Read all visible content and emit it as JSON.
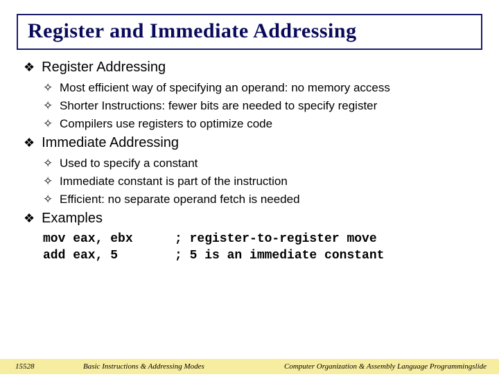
{
  "title": "Register and Immediate Addressing",
  "sections": [
    {
      "heading": "Register Addressing",
      "items": [
        "Most efficient way of specifying an operand: no memory access",
        "Shorter Instructions: fewer bits are needed to specify register",
        "Compilers use registers to optimize code"
      ]
    },
    {
      "heading": "Immediate Addressing",
      "items": [
        "Used to specify a constant",
        "Immediate constant is part of the instruction",
        "Efficient: no separate operand fetch is needed"
      ]
    },
    {
      "heading": "Examples",
      "code": [
        {
          "left": "mov eax, ebx",
          "right": "; register-to-register move"
        },
        {
          "left": "add eax, 5",
          "right": "; 5 is an immediate constant"
        }
      ]
    }
  ],
  "footer": {
    "left": "15528",
    "center": "Basic Instructions & Addressing Modes",
    "right": "Computer Organization & Assembly Language Programmingslide"
  },
  "bullets": {
    "diamond": "❖",
    "plus": "✧"
  }
}
